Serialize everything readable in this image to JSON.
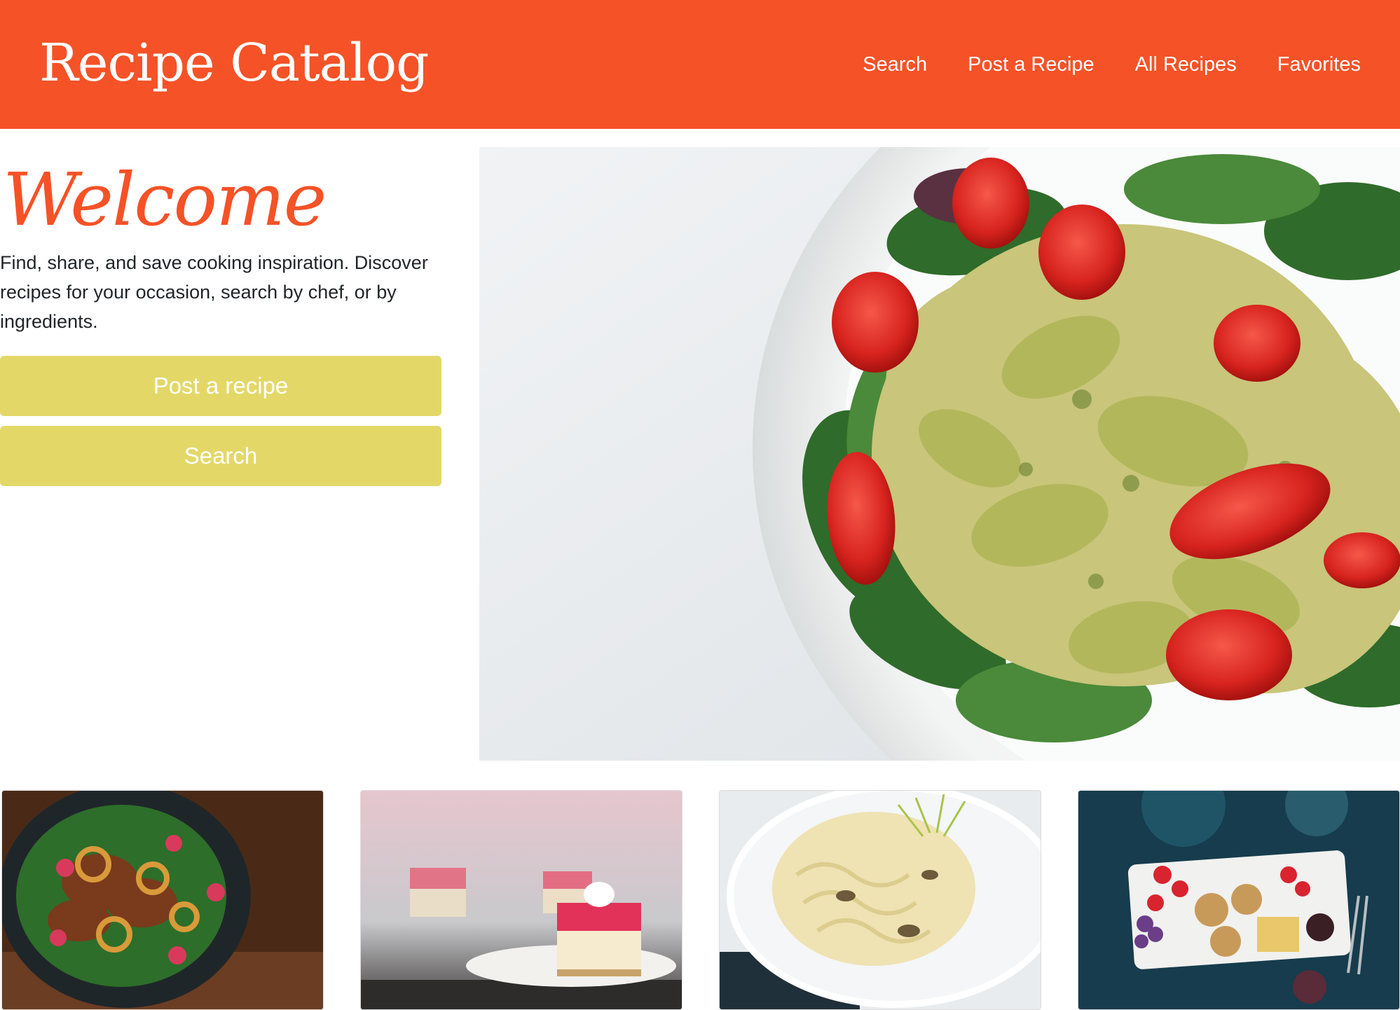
{
  "navbar": {
    "brand": "Recipe Catalog",
    "links": [
      "Search",
      "Post a Recipe",
      "All Recipes",
      "Favorites"
    ]
  },
  "hero": {
    "title": "Welcome",
    "lead": "Find, share, and save cooking inspiration. Discover recipes for your occasion, search by chef, or by ingredients.",
    "buttons": {
      "post": "Post a recipe",
      "search": "Search"
    },
    "image": "pasta-salad-image"
  },
  "cards": [
    {
      "image": "salad-with-meat-image"
    },
    {
      "image": "raspberry-cheesecake-image"
    },
    {
      "image": "fettuccine-pasta-image"
    },
    {
      "image": "fruit-cheese-board-image"
    }
  ],
  "colors": {
    "brand": "#f55227",
    "button": "#e3d867",
    "text": "#212529"
  }
}
